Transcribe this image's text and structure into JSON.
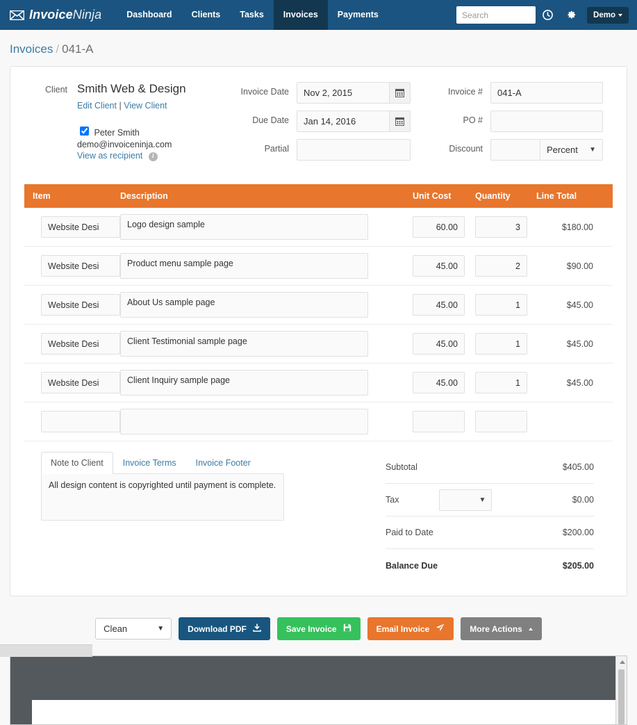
{
  "navbar": {
    "brand_bold": "Invoice",
    "brand_light": "Ninja",
    "envelope_icon": "envelope-icon",
    "links": [
      {
        "label": "Dashboard",
        "active": false
      },
      {
        "label": "Clients",
        "active": false
      },
      {
        "label": "Tasks",
        "active": false
      },
      {
        "label": "Invoices",
        "active": true
      },
      {
        "label": "Payments",
        "active": false
      }
    ],
    "search_placeholder": "Search",
    "search_value": "",
    "clock_icon": "clock-icon",
    "gear_icon": "gear-icon",
    "account_label": "Demo"
  },
  "breadcrumb": {
    "root": "Invoices",
    "separator": "/",
    "current": "041-A"
  },
  "invoice": {
    "client_label": "Client",
    "client_name": "Smith Web & Design",
    "edit_client_link": "Edit Client",
    "link_divider": "|",
    "view_client_link": "View Client",
    "contact_name": "Peter Smith",
    "contact_email": "demo@invoiceninja.com",
    "view_as_recipient": "View as recipient",
    "info_glyph": "i",
    "fields": {
      "invoice_date_label": "Invoice Date",
      "invoice_date_value": "Nov 2, 2015",
      "due_date_label": "Due Date",
      "due_date_value": "Jan 14, 2016",
      "partial_label": "Partial",
      "partial_value": "",
      "invoice_no_label": "Invoice #",
      "invoice_no_value": "041-A",
      "po_label": "PO #",
      "po_value": "",
      "discount_label": "Discount",
      "discount_value": "",
      "discount_type": "Percent",
      "calendar_icon": "calendar-icon"
    }
  },
  "items_table": {
    "columns": [
      "Item",
      "Description",
      "Unit Cost",
      "Quantity",
      "Line Total"
    ],
    "rows": [
      {
        "item": "Website Desi",
        "description": "Logo design sample",
        "unit_cost": "60.00",
        "quantity": "3",
        "line_total": "$180.00"
      },
      {
        "item": "Website Desi",
        "description": "Product menu sample page",
        "unit_cost": "45.00",
        "quantity": "2",
        "line_total": "$90.00"
      },
      {
        "item": "Website Desi",
        "description": "About Us sample page",
        "unit_cost": "45.00",
        "quantity": "1",
        "line_total": "$45.00"
      },
      {
        "item": "Website Desi",
        "description": "Client Testimonial sample page",
        "unit_cost": "45.00",
        "quantity": "1",
        "line_total": "$45.00"
      },
      {
        "item": "Website Desi",
        "description": "Client Inquiry sample page",
        "unit_cost": "45.00",
        "quantity": "1",
        "line_total": "$45.00"
      },
      {
        "item": "",
        "description": "",
        "unit_cost": "",
        "quantity": "",
        "line_total": ""
      }
    ]
  },
  "notes": {
    "tabs": [
      {
        "label": "Note to Client",
        "active": true
      },
      {
        "label": "Invoice Terms",
        "active": false
      },
      {
        "label": "Invoice Footer",
        "active": false
      }
    ],
    "body": "All design content is copyrighted until payment is complete."
  },
  "totals": {
    "subtotal_label": "Subtotal",
    "subtotal_value": "$405.00",
    "tax_label": "Tax",
    "tax_select_value": "",
    "tax_value": "$0.00",
    "paid_label": "Paid to Date",
    "paid_value": "$200.00",
    "balance_label": "Balance Due",
    "balance_value": "$205.00"
  },
  "actions": {
    "template_value": "Clean",
    "download_pdf": "Download PDF",
    "save_invoice": "Save Invoice",
    "email_invoice": "Email Invoice",
    "more_actions": "More Actions",
    "download_icon": "download-icon",
    "save-icon": "floppy-icon",
    "email_icon": "paper-plane-icon"
  },
  "colors": {
    "navbar_blue": "#1b5480",
    "navbar_active": "#12374f",
    "accent_orange": "#e8762c",
    "green": "#36c15c",
    "pdf_blue": "#18567f",
    "gray": "#808080",
    "link_blue": "#3b7ca5"
  }
}
